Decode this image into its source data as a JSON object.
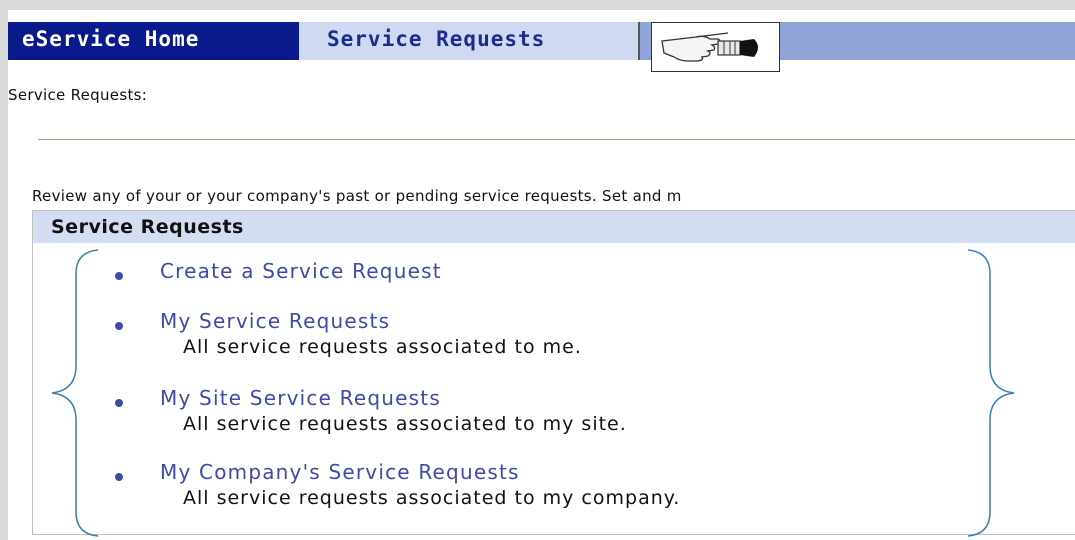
{
  "tabs": {
    "home": "eService Home",
    "active": "Service Requests"
  },
  "page": {
    "section_label": "Service Requests:",
    "intro": "Review any of your or your company's past or pending service requests. Set and m"
  },
  "panel": {
    "title": "Service Requests",
    "items": [
      {
        "link": "Create a Service Request",
        "desc": ""
      },
      {
        "link": "My Service Requests",
        "desc": "All service requests associated to me."
      },
      {
        "link": "My Site Service Requests",
        "desc": "All service requests associated to my site."
      },
      {
        "link": "My Company's Service Requests",
        "desc": "All service requests associated to my company."
      }
    ]
  },
  "colors": {
    "tab_dark": "#0b1a8a",
    "tab_bar": "#8fa3d6",
    "tab_active": "#cfd9f1",
    "panel_header": "#d4def2",
    "link": "#3e4aa6",
    "brace": "#3a7fb0"
  },
  "icons": {
    "tab_decoration": "pointing-hand-lightbulb-icon",
    "list_marker": "bullet-icon"
  }
}
